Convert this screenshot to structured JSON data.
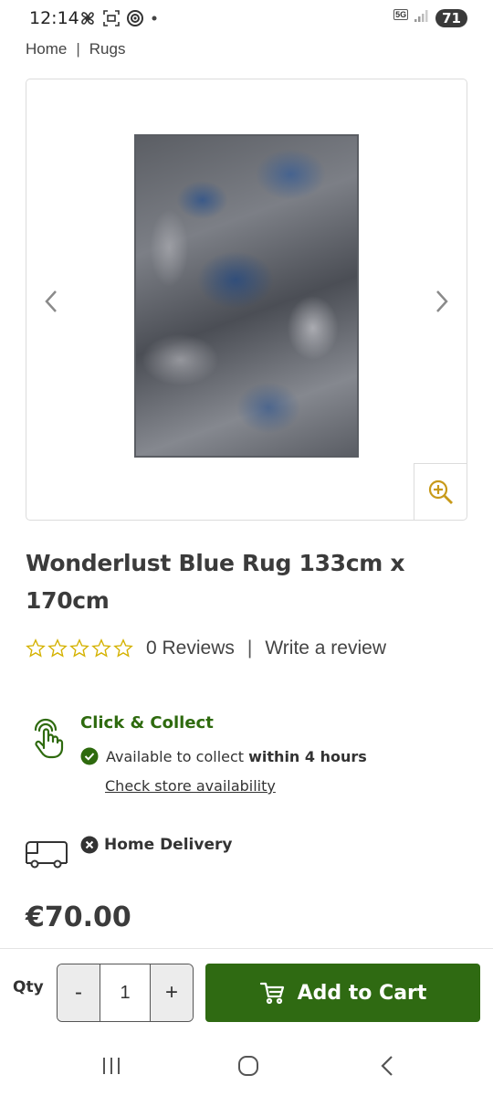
{
  "status_bar": {
    "time": "12:14",
    "network": "5G",
    "battery": "71"
  },
  "breadcrumb": {
    "items": [
      "Home",
      "Rugs"
    ],
    "separator": "|"
  },
  "product": {
    "title": "Wonderlust Blue Rug 133cm x 170cm",
    "rating": 0,
    "review_count_label": "0 Reviews",
    "write_review_label": "Write a review",
    "price": "€70.00"
  },
  "click_collect": {
    "title": "Click & Collect",
    "available_prefix": "Available to collect",
    "available_bold": "within 4 hours",
    "check_link": "Check store availability"
  },
  "home_delivery": {
    "label": "Home Delivery",
    "available": false
  },
  "cart": {
    "qty_label": "Qty",
    "minus": "-",
    "quantity": "1",
    "plus": "+",
    "add_label": "Add to Cart"
  },
  "colors": {
    "brand_green": "#2f6a12",
    "title_green": "#2e6a0e",
    "star_yellow": "#d4b200",
    "zoom_gold": "#c89a1a"
  }
}
